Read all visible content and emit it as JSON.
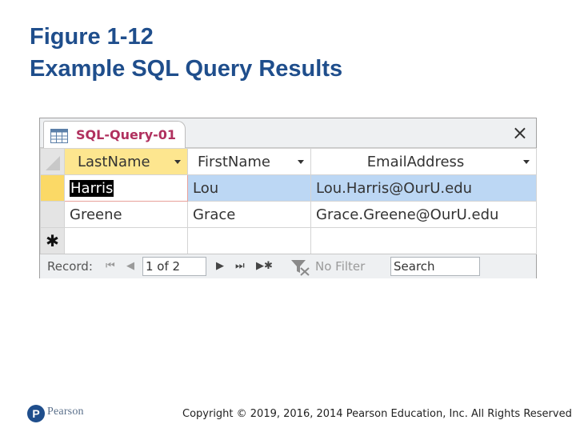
{
  "slide": {
    "title_line1": "Figure 1-12",
    "title_line2": "Example SQL Query Results"
  },
  "window": {
    "tab_label": "SQL-Query-01",
    "tab_icon": "query-datasheet-icon",
    "close_glyph": "×"
  },
  "grid": {
    "columns": [
      "LastName",
      "FirstName",
      "EmailAddress"
    ],
    "rows": [
      {
        "LastName": "Harris",
        "FirstName": "Lou",
        "EmailAddress": "Lou.Harris@OurU.edu"
      },
      {
        "LastName": "Greene",
        "FirstName": "Grace",
        "EmailAddress": "Grace.Greene@OurU.edu"
      }
    ],
    "new_record_glyph": "✱"
  },
  "navbar": {
    "record_label": "Record:",
    "position": "1 of 2",
    "first_glyph": "⏮",
    "prev_glyph": "◀",
    "next_glyph": "▶",
    "last_glyph": "⏭",
    "new_glyph": "▶✱",
    "filter_label": "No Filter",
    "search_text": "Search"
  },
  "footer": {
    "logo_letter": "P",
    "logo_text": "Pearson",
    "copyright": "Copyright © 2019, 2016, 2014 Pearson Education, Inc. All Rights Reserved"
  },
  "colors": {
    "title": "#1f4e8c",
    "tab_label": "#b0305e",
    "active_header": "#fde68f",
    "selected_row": "#bcd7f4"
  }
}
